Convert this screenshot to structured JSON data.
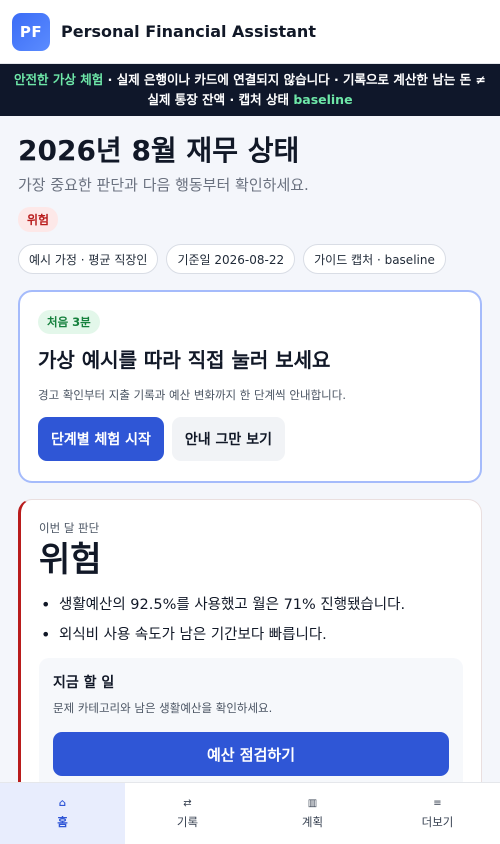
{
  "header": {
    "logo_text": "PF",
    "title": "Personal Financial Assistant"
  },
  "banner": {
    "highlight": "안전한 가상 체험",
    "line1_rest": " · 실제 은행이나 카드에 연결되지 않습니다 · 기록으로 계산한 남는 돈 ≠",
    "line2_prefix": "실제 통장 잔액 · 캡처 상태 ",
    "line2_highlight": "baseline"
  },
  "page": {
    "title": "2026년 8월 재무 상태",
    "subtitle": "가장 중요한 판단과 다음 행동부터 확인하세요.",
    "status_badge": "위험",
    "chips": [
      "예시 가정 · 평균 직장인",
      "기준일 2026-08-22",
      "가이드 캡처 · baseline"
    ]
  },
  "guide": {
    "badge": "처음 3분",
    "title": "가상 예시를 따라 직접 눌러 보세요",
    "description": "경고 확인부터 지출 기록과 예산 변화까지 한 단계씩 안내합니다.",
    "start_button": "단계별 체험 시작",
    "dismiss_button": "안내 그만 보기"
  },
  "verdict": {
    "label": "이번 달 판단",
    "value": "위험",
    "reasons": [
      "생활예산의 92.5%를 사용했고 월은 71% 진행됐습니다.",
      "외식비 사용 속도가 남은 기간보다 빠릅니다."
    ],
    "todo": {
      "title": "지금 할 일",
      "description": "문제 카테고리와 남은 생활예산을 확인하세요.",
      "button": "예산 점검하기"
    }
  },
  "nav": {
    "items": [
      {
        "icon": "⌂",
        "label": "홈"
      },
      {
        "icon": "⇄",
        "label": "기록"
      },
      {
        "icon": "▥",
        "label": "계획"
      },
      {
        "icon": "≡",
        "label": "더보기"
      }
    ]
  },
  "colors": {
    "accent": "#2f56d6",
    "danger": "#b91c1c",
    "banner_bg": "#0f172a",
    "banner_highlight": "#6ee7a8"
  }
}
